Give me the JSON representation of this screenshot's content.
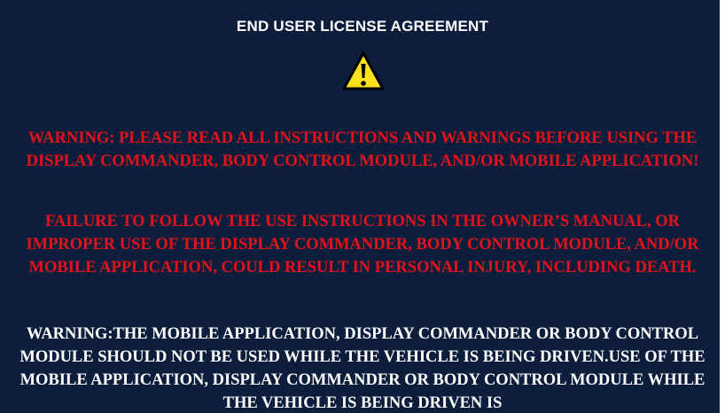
{
  "header": {
    "title": "END USER LICENSE AGREEMENT",
    "icon": "warning-triangle-icon"
  },
  "colors": {
    "background": "#0c1e3c",
    "warning_red": "#e3121b",
    "text_white": "#ffffff",
    "icon_yellow": "#f9e21b"
  },
  "paragraphs": {
    "warning_read_instructions": "WARNING: PLEASE READ ALL INSTRUCTIONS AND WARNINGS BEFORE USING THE DISPLAY COMMANDER, BODY CONTROL MODULE, AND/OR MOBILE APPLICATION!",
    "failure_to_follow": "FAILURE TO FOLLOW THE USE INSTRUCTIONS IN THE OWNER’S MANUAL, OR IMPROPER USE OF THE DISPLAY COMMANDER, BODY CONTROL MODULE, AND/OR MOBILE APPLICATION, COULD RESULT IN PERSONAL INJURY, INCLUDING DEATH.",
    "warning_while_driven": "WARNING:THE MOBILE APPLICATION, DISPLAY COMMANDER OR BODY CONTROL MODULE SHOULD NOT BE USED WHILE THE VEHICLE IS BEING DRIVEN.USE OF THE MOBILE APPLICATION, DISPLAY COMMANDER OR BODY CONTROL MODULE WHILE THE VEHICLE IS BEING DRIVEN IS"
  }
}
